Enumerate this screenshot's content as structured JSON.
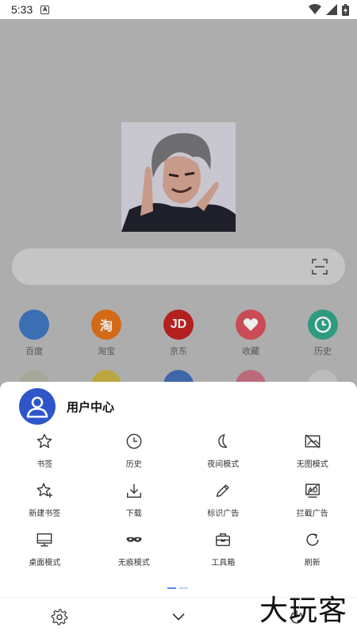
{
  "status_bar": {
    "time": "5:33",
    "notif_glyph": "A"
  },
  "shortcuts": [
    {
      "label": "百度",
      "icon": "baidu-icon",
      "color": "#3b6fb4",
      "glyph": ""
    },
    {
      "label": "淘宝",
      "icon": "taobao-icon",
      "color": "#d36a17",
      "glyph": "淘"
    },
    {
      "label": "京东",
      "icon": "jd-icon",
      "color": "#b3201f",
      "glyph": "JD"
    },
    {
      "label": "收藏",
      "icon": "heart-icon",
      "color": "#c94b55",
      "glyph": ""
    },
    {
      "label": "历史",
      "icon": "clock-icon",
      "color": "#2e9a80",
      "glyph": ""
    }
  ],
  "user_center": {
    "title": "用户中心"
  },
  "menu": [
    {
      "label": "书签",
      "icon": "star-icon"
    },
    {
      "label": "历史",
      "icon": "clock-icon"
    },
    {
      "label": "夜间模式",
      "icon": "moon-icon"
    },
    {
      "label": "无图模式",
      "icon": "no-image-icon"
    },
    {
      "label": "新建书签",
      "icon": "star-plus-icon"
    },
    {
      "label": "下载",
      "icon": "download-icon"
    },
    {
      "label": "标识广告",
      "icon": "pencil-icon"
    },
    {
      "label": "拦截广告",
      "icon": "block-ad-icon"
    },
    {
      "label": "桌面模式",
      "icon": "desktop-icon"
    },
    {
      "label": "无痕模式",
      "icon": "mask-icon"
    },
    {
      "label": "工具箱",
      "icon": "toolbox-icon"
    },
    {
      "label": "刷新",
      "icon": "refresh-icon"
    }
  ],
  "watermark": "大玩客",
  "colors": {
    "accent": "#2f56c9",
    "overlay": "#adadad"
  }
}
